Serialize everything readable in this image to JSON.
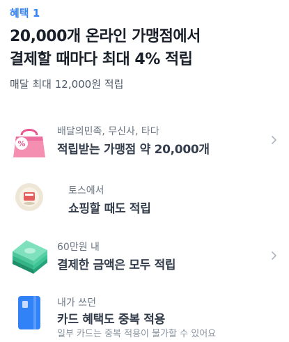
{
  "header": {
    "badge": "혜택 1",
    "title_line1": "20,000개 온라인 가맹점에서",
    "title_line2": "결제할 때마다 최대 4% 적립",
    "subtitle": "매달 최대 12,000원 적립"
  },
  "benefits": [
    {
      "icon": "shopping-bag-icon",
      "caption": "배달의민족, 무신사, 타다",
      "title": "적립받는 가맹점 약 20,000개",
      "has_chevron": true
    },
    {
      "icon": "toss-coin-icon",
      "caption": "토스에서",
      "title": "쇼핑할 때도 적립",
      "has_chevron": false
    },
    {
      "icon": "money-stack-icon",
      "caption": "60만원 내",
      "title": "결제한 금액은 모두 적립",
      "has_chevron": true
    },
    {
      "icon": "credit-card-icon",
      "caption": "내가 쓰던",
      "title": "카드 혜택도 중복 적용",
      "note": "일부 카드는 중복 적용이 불가할 수 있어요",
      "has_chevron": false
    }
  ],
  "colors": {
    "accent": "#3182f6",
    "title": "#191f28",
    "body": "#333d4b",
    "muted": "#8b95a1"
  }
}
